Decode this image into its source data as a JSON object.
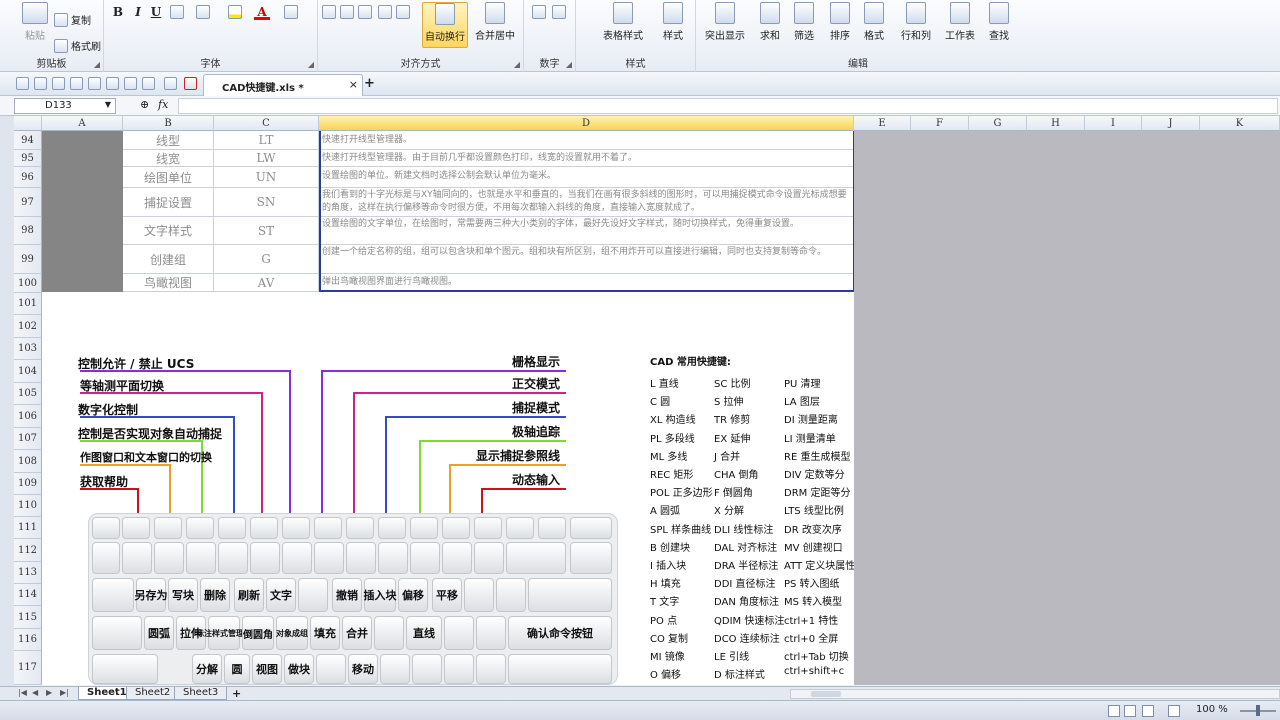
{
  "ribbon": {
    "clipboard": {
      "paste": "粘贴",
      "copy": "复制",
      "format_painter": "格式刷",
      "label": "剪贴板"
    },
    "font": {
      "bold": "B",
      "italic": "I",
      "underline": "U",
      "font_color_glyph": "A",
      "label": "字体"
    },
    "alignment": {
      "wrap_text": "自动换行",
      "merge_center": "合并居中",
      "label": "对齐方式"
    },
    "number": {
      "label": "数字"
    },
    "styles": {
      "table_style": "表格样式",
      "cell_style": "样式",
      "label": "样式"
    },
    "editing": {
      "highlight": "突出显示",
      "sum": "求和",
      "filter": "筛选",
      "sort": "排序",
      "format": "格式",
      "rows_cols": "行和列",
      "worksheet": "工作表",
      "find": "查找",
      "label": "编辑"
    }
  },
  "document": {
    "tab_title": "CAD快捷键.xls *",
    "close_glyph": "×",
    "new_tab_glyph": "+"
  },
  "formula_bar": {
    "cell_ref": "D133",
    "fx_label": "fx"
  },
  "columns": [
    "A",
    "B",
    "C",
    "D",
    "E",
    "F",
    "G",
    "H",
    "I",
    "J",
    "K"
  ],
  "selected_column": "D",
  "rows": [
    "94",
    "95",
    "96",
    "97",
    "98",
    "99",
    "100",
    "101",
    "102",
    "103",
    "104",
    "105",
    "106",
    "107",
    "108",
    "109",
    "110",
    "111",
    "112",
    "113",
    "114",
    "115",
    "116",
    "117"
  ],
  "table_rows": [
    {
      "cmd": "线型",
      "key": "LT",
      "desc": "快速打开线型管理器。"
    },
    {
      "cmd": "线宽",
      "key": "LW",
      "desc": "快速打开线型管理器。由于目前几乎都设置颜色打印，线宽的设置就用不着了。"
    },
    {
      "cmd": "绘图单位",
      "key": "UN",
      "desc": "设置绘图的单位。新建文档时选择公制会默认单位为毫米。"
    },
    {
      "cmd": "捕捉设置",
      "key": "SN",
      "desc": "我们看到的十字光标是与XY轴同向的，也就是水平和垂直的，当我们在画有很多斜线的图形时，可以用捕捉模式命令设置光标成想要的角度，这样在执行偏移等命令时很方便，不用每次都输入斜线的角度，直接输入宽度就成了。"
    },
    {
      "cmd": "文字样式",
      "key": "ST",
      "desc": "设置绘图的文字单位，在绘图时，常需要两三种大小类别的字体，最好先设好文字样式，随时切换样式，免得重复设置。"
    },
    {
      "cmd": "创建组",
      "key": "G",
      "desc": "创建一个给定名称的组，组可以包含块和单个图元。组和块有所区别，组不用炸开可以直接进行编辑，同时也支持复制等命令。"
    },
    {
      "cmd": "鸟瞰视图",
      "key": "AV",
      "desc": "弹出鸟瞰视图界面进行鸟瞰视图。"
    }
  ],
  "diagram": {
    "left_callouts": [
      "控制允许 / 禁止 UCS",
      "等轴测平面切换",
      "数字化控制",
      "控制是否实现对象自动捕捉",
      "作图窗口和文本窗口的切换",
      "获取帮助"
    ],
    "right_callouts": [
      "栅格显示",
      "正交模式",
      "捕捉模式",
      "极轴追踪",
      "显示捕捉参照线",
      "动态输入"
    ],
    "key_labels": {
      "row3": [
        "另存为",
        "写块",
        "删除",
        "刷新",
        "文字",
        "撤销",
        "插入块",
        "偏移",
        "平移"
      ],
      "row4": [
        "圆弧",
        "拉伸",
        "标注样式管理器",
        "倒圆角",
        "对象成组",
        "填充",
        "合并",
        "直线",
        "确认命令按钮"
      ],
      "row5": [
        "分解",
        "圆",
        "视图",
        "做块",
        "移动"
      ]
    },
    "shortcut_title": "CAD 常用快捷键:",
    "shortcuts": [
      [
        "L 直线",
        "SC 比例",
        "PU 清理"
      ],
      [
        "C 圆",
        "S 拉伸",
        "LA 图层"
      ],
      [
        "XL 构造线",
        "TR 修剪",
        "DI 测量距离"
      ],
      [
        "PL 多段线",
        "EX 延伸",
        "LI 测量清单"
      ],
      [
        "ML 多线",
        "J 合并",
        "RE 重生成模型"
      ],
      [
        "REC 矩形",
        "CHA 倒角",
        "DIV 定数等分"
      ],
      [
        "POL 正多边形",
        "F 倒圆角",
        "DRM 定距等分"
      ],
      [
        "A 圆弧",
        "X 分解",
        "LTS 线型比例"
      ],
      [
        "SPL 样条曲线",
        "DLI 线性标注",
        "DR 改变次序"
      ],
      [
        "B 创建块",
        "DAL 对齐标注",
        "MV 创建视口"
      ],
      [
        "I 插入块",
        "DRA 半径标注",
        "ATT 定义块属性"
      ],
      [
        "H 填充",
        "DDI 直径标注",
        "PS 转入图纸"
      ],
      [
        "T 文字",
        "DAN 角度标注",
        "MS 转入模型"
      ],
      [
        "PO 点",
        "QDIM 快速标注",
        "ctrl+1 特性"
      ],
      [
        "CO 复制",
        "DCO 连续标注",
        "ctrl+0 全屏"
      ],
      [
        "MI 镜像",
        "LE 引线",
        "ctrl+Tab 切换"
      ],
      [
        "O 偏移",
        "D 标注样式",
        "ctrl+shift+c"
      ]
    ]
  },
  "sheets": [
    "Sheet1",
    "Sheet2",
    "Sheet3"
  ],
  "active_sheet": "Sheet1",
  "add_sheet_glyph": "+",
  "status": {
    "zoom": "100 %"
  },
  "colors": {
    "selected_header": "#f7d257",
    "column_a_fill": "#858585",
    "selection_border": "#2b3b9a",
    "outside_area": "#b9b9bf"
  }
}
